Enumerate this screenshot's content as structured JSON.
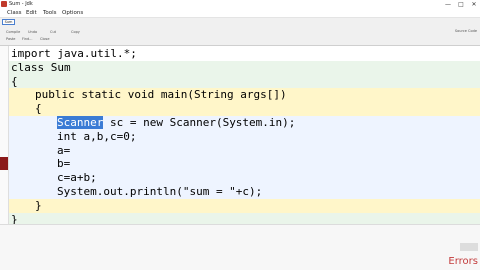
{
  "window": {
    "title": "Sum - Jdk",
    "minimize": "—",
    "maximize": "□",
    "close": "✕"
  },
  "menu": {
    "items": [
      "Class",
      "Edit",
      "Tools",
      "Options"
    ]
  },
  "toolbar": {
    "doc_tab": "Sum",
    "row1": [
      "Compile",
      "Undo",
      "Cut",
      "Copy"
    ],
    "row2": [
      "Paste",
      "Find...",
      "Close"
    ],
    "right_tool": "Source Code"
  },
  "editor": {
    "lines": [
      "import java.util.*;",
      "class Sum",
      "{",
      "public static void main(String args[])",
      "{",
      "Scanner",
      " sc = new Scanner(System.in);",
      "int a,b,c=0;",
      "a=",
      "b=",
      "c=a+b;",
      "System.out.println(\"sum = \"+c);",
      "}",
      "}"
    ]
  },
  "status": {
    "errors_label": "Errors"
  }
}
